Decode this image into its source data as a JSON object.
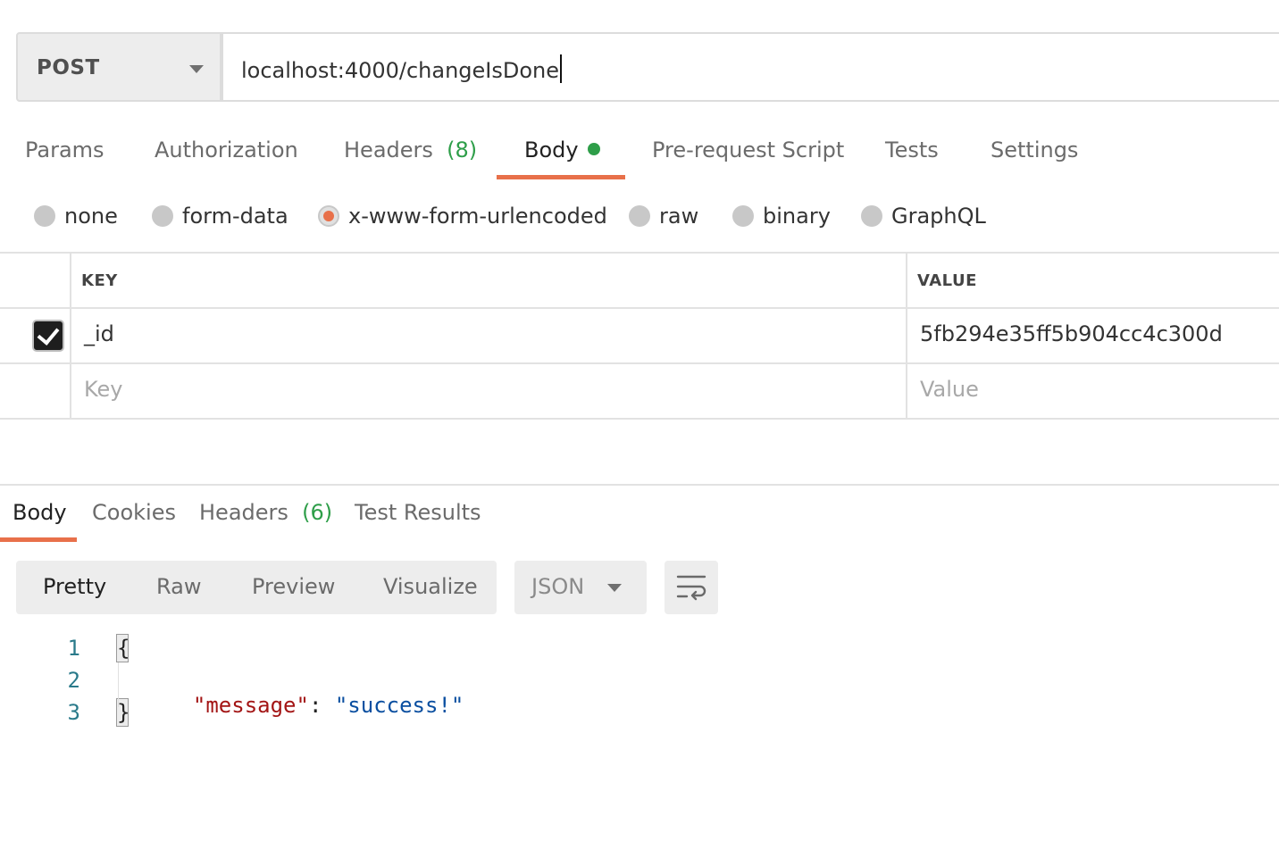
{
  "request": {
    "method": "POST",
    "url": "localhost:4000/changeIsDone"
  },
  "request_tabs": {
    "params": "Params",
    "authorization": "Authorization",
    "headers": "Headers",
    "headers_count": "(8)",
    "body": "Body",
    "pre_request": "Pre-request Script",
    "tests": "Tests",
    "settings": "Settings"
  },
  "body_types": {
    "none": "none",
    "form_data": "form-data",
    "urlencoded": "x-www-form-urlencoded",
    "raw": "raw",
    "binary": "binary",
    "graphql": "GraphQL",
    "selected": "x-www-form-urlencoded"
  },
  "params_table": {
    "headers": {
      "key": "KEY",
      "value": "VALUE"
    },
    "rows": [
      {
        "checked": true,
        "key": "_id",
        "value": "5fb294e35ff5b904cc4c300d"
      }
    ],
    "new_row": {
      "key_placeholder": "Key",
      "value_placeholder": "Value"
    }
  },
  "response_tabs": {
    "body": "Body",
    "cookies": "Cookies",
    "headers": "Headers",
    "headers_count": "(6)",
    "test_results": "Test Results"
  },
  "response_view": {
    "modes": {
      "pretty": "Pretty",
      "raw": "Raw",
      "preview": "Preview",
      "visualize": "Visualize"
    },
    "format": "JSON",
    "wrap_icon": "wrap-lines-icon"
  },
  "response_body": {
    "line_numbers": [
      "1",
      "2",
      "3"
    ],
    "open_brace": "{",
    "key": "\"message\"",
    "colon": ": ",
    "value": "\"success!\"",
    "close_brace": "}"
  },
  "colors": {
    "accent": "#e8704a",
    "count_green": "#2e9e49",
    "json_key": "#a31515",
    "json_string": "#0b4fa0"
  }
}
